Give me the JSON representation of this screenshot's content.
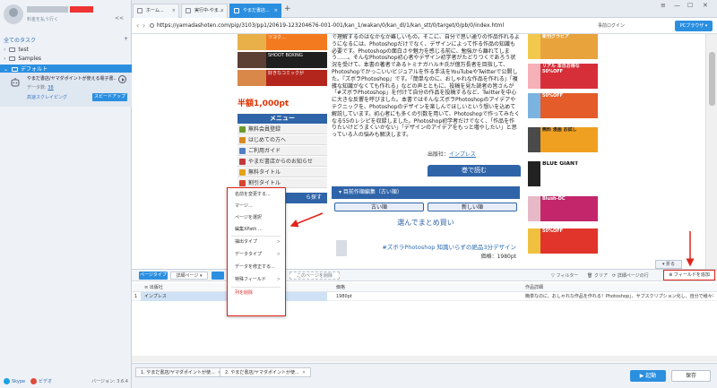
{
  "sidebar": {
    "plan_text": "料金を払う行く",
    "collapse": "<<",
    "tasks_header": "全てのタスク",
    "add": "+",
    "tree": [
      {
        "label": "test"
      },
      {
        "label": "Samples"
      },
      {
        "label": "デフォルト"
      }
    ],
    "task": {
      "name": "やまだ書店/ヤマダポイントが使える電子書...",
      "sub_prefix": "データ数:",
      "sub_value": "38",
      "mode": "高速スクレイピング",
      "speed_button": "スピードアップ"
    },
    "footer": {
      "skype": "Skype",
      "guide": "ビデオ",
      "version": "バージョン: 3.6.4"
    }
  },
  "tabs": [
    {
      "label": "ホーム..."
    },
    {
      "label": "実行中-やま..."
    },
    {
      "label": "やまだ書店..."
    }
  ],
  "newtab": "+",
  "window_buttons": [
    "≡",
    "—",
    "☐",
    "✕"
  ],
  "address": {
    "url": "https://yamadashoten.com/pip/3103/pp1/20619-123204676-001-001/kan_1/wakan/0/kan_dl/1/kan_stt/0/target/0/pb/0/index.html",
    "login": "事前ログイン",
    "browser_button": "PCブラウザ ▾",
    "back": "‹",
    "forward": "›"
  },
  "web": {
    "ads_left": [
      {
        "text": "ツヨク…"
      },
      {
        "text": "SHOOT BOXING"
      },
      {
        "text": "好きなコミックが"
      }
    ],
    "big_price": "半額1,000pt",
    "menu_title": "メニュー",
    "menu_items": [
      {
        "label": "無料会員登録"
      },
      {
        "label": "はじめての方へ"
      },
      {
        "label": "ご利用ガイド"
      },
      {
        "label": "やまだ書店からのお知らせ"
      },
      {
        "label": "無料タイトル"
      },
      {
        "label": "割引タイトル"
      }
    ],
    "search_bar": "ら探す",
    "article": "で理解するのはなかなか難しいもの。そこに、自分で思い通りの作品作れるようになるには、Photoshopだけでなく、デザインによって作る作品の知識も必要です。Photoshopの面白さや魅力を感じる前に、勉強から離れてしまう……。そんなPhotoshop初心者やデザイン初学者がたどりつくであろう状況を受けて、本書の著者であるトミナガハルキ氏が億万長者を目指して、Photoshopでかっこいいビジュアルを作る手法をYouTubeやTwitterで公開した。『ズボラPhotoshop』です。「簡単なのに、おしゃれな作品を作れる」「複雑な知識がなくても作れる」などの声とともに、投稿を見た読者の皆さんが「#ズボラPhotoshop」を付けて自分の作品を投稿するなど、Twitterを中心に大きな反響を呼びました。本書ではそんなズボラPhotoshopのアイデアやテクニックを、Photoshopのデザインを楽しんでほしいという想いを込めて解説しています。初心者にも多くの引数を用いて、Photoshopで作ってみたくなる55のレシピを収録しました。Photoshop初学者だけでなく、「作品を作りたいけどうまくいかない」「デザインのアイデアをもっと増やしたい」と思っている人の悩みも解決します。",
    "source_label": "出版社：",
    "source_value": "インプレス",
    "read_button": "巻で読む",
    "order_bar": "▾ 目前作順編集（古い順）",
    "order_old": "古い順",
    "order_new": "新しい順",
    "pick_title": "選んでまとめ買い",
    "product_line": "#ズボラPhotoshop 知識いらずの絶品3分デザイン",
    "price_line": "価格：1980pt",
    "right_ads": [
      {
        "text": "新刊グラビア"
      },
      {
        "text": "リアル 本日お得な 50%OFF"
      },
      {
        "text": "50%OFF"
      },
      {
        "text": "無料 漫画 お試し"
      },
      {
        "text": "BLUE GIANT"
      },
      {
        "text": "Blush-DC"
      },
      {
        "text": "50%OFF"
      }
    ],
    "bottom_chip": "▾ 折る"
  },
  "context_menu": {
    "items": [
      {
        "label": "名前を変更する...",
        "arrow": ""
      },
      {
        "label": "マージ...",
        "arrow": ""
      },
      {
        "label": "ページを選択",
        "arrow": ""
      },
      {
        "label": "編集XPath ...",
        "arrow": ""
      },
      {
        "label": "抽出タイプ",
        "arrow": ">"
      },
      {
        "label": "データタイプ",
        "arrow": ">"
      },
      {
        "label": "データを修正する...",
        "arrow": ""
      },
      {
        "label": "特殊フィールド",
        "arrow": ">"
      },
      {
        "label": "列を削除",
        "arrow": ""
      }
    ]
  },
  "panel": {
    "toolbar": {
      "page_type": "ページタイプ",
      "detail_page": "詳細ページ ▾",
      "dropdown2": "",
      "delete_page": "このページを削除",
      "filter": "フィルター",
      "clear": "クリア",
      "detail_exec": "詳細ページの行",
      "add_field": "⊕ フィールドを追加"
    },
    "columns": [
      "出版社",
      "価格",
      "作品詳細"
    ],
    "rows": [
      {
        "num": "1",
        "cells": [
          "インプレス",
          "1980pt",
          "簡単なのに、おしゃれな作品を作れる！Photoshop」、サブスクリプション化し、自分で様々な作品を..."
        ]
      }
    ]
  },
  "bottom": {
    "tabs": [
      {
        "label": "1. やまだ書店/ヤマダポイントが使...",
        "close": "✕"
      },
      {
        "label": "2. やまだ書店/ヤマダポイントが使...",
        "close": "✕"
      }
    ],
    "run": "▶ 起動",
    "save": "保存"
  }
}
